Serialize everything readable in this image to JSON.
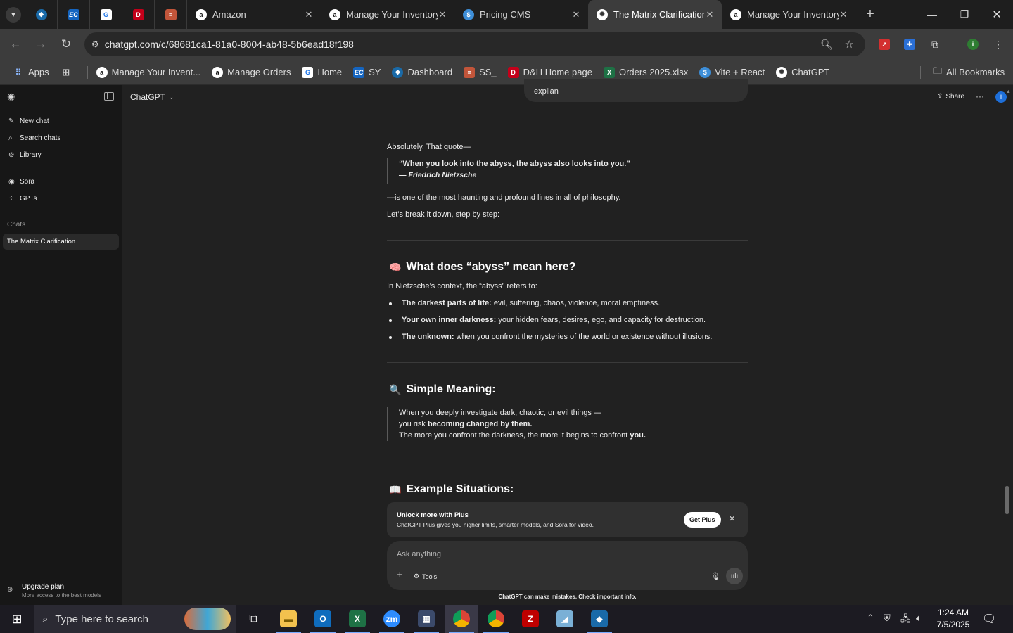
{
  "browser": {
    "tabs": [
      {
        "title": "Amazon",
        "icon": "amazon-icon"
      },
      {
        "title": "Manage Your Inventory",
        "icon": "amazon-icon"
      },
      {
        "title": "Pricing CMS",
        "icon": "dollar-icon"
      },
      {
        "title": "The Matrix Clarification",
        "icon": "chatgpt-icon",
        "active": true
      },
      {
        "title": "Manage Your Inventory",
        "icon": "amazon-icon"
      }
    ],
    "url": "chatgpt.com/c/68681ca1-81a0-8004-ab48-5b6ead18f198",
    "bookmarks": [
      {
        "label": "Apps",
        "icon": "apps-grid-icon"
      },
      {
        "label": "",
        "icon": "tab-groups-icon"
      },
      {
        "label": "Manage Your Invent...",
        "icon": "amazon-icon"
      },
      {
        "label": "Manage Orders",
        "icon": "amazon-icon"
      },
      {
        "label": "Home",
        "icon": "home-doc-icon"
      },
      {
        "label": "SY",
        "icon": "ec-icon"
      },
      {
        "label": "Dashboard",
        "icon": "diamond-icon"
      },
      {
        "label": "SS_",
        "icon": "stack-icon"
      },
      {
        "label": "D&H Home page",
        "icon": "dh-icon"
      },
      {
        "label": "Orders 2025.xlsx",
        "icon": "excel-icon"
      },
      {
        "label": "Vite + React",
        "icon": "dollar-icon"
      },
      {
        "label": "ChatGPT",
        "icon": "chatgpt-icon"
      }
    ],
    "all_bookmarks": "All Bookmarks"
  },
  "sidebar": {
    "nav": [
      {
        "label": "New chat",
        "icon": "edit-icon"
      },
      {
        "label": "Search chats",
        "icon": "search-icon"
      },
      {
        "label": "Library",
        "icon": "library-icon"
      },
      {
        "label": "Sora",
        "icon": "sora-icon"
      },
      {
        "label": "GPTs",
        "icon": "grid-icon"
      }
    ],
    "section_label": "Chats",
    "chats": [
      "The Matrix Clarification"
    ],
    "upgrade": {
      "title": "Upgrade plan",
      "subtitle": "More access to the best models"
    }
  },
  "header": {
    "model": "ChatGPT",
    "share": "Share",
    "avatar_letter": "I"
  },
  "conversation": {
    "user_message": "explian",
    "intro": "Absolutely. That quote—",
    "quote": "“When you look into the abyss, the abyss also looks into you.”",
    "quote_author": "— Friedrich Nietzsche",
    "p1": "—is one of the most haunting and profound lines in all of philosophy.",
    "p2": "Let’s break it down, step by step:",
    "section1_title": "What does “abyss” mean here?",
    "section1_emoji": "🧠",
    "section1_intro": "In Nietzsche’s context, the “abyss” refers to:",
    "bullets": [
      {
        "bold": "The darkest parts of life:",
        "text": " evil, suffering, chaos, violence, moral emptiness."
      },
      {
        "bold": "Your own inner darkness:",
        "text": " your hidden fears, desires, ego, and capacity for destruction."
      },
      {
        "bold": "The unknown:",
        "text": " when you confront the mysteries of the world or existence without illusions."
      }
    ],
    "section2_title": "Simple Meaning:",
    "section2_emoji": "🔍",
    "simple_line1": "When you deeply investigate dark, chaotic, or evil things —",
    "simple_line2_pre": "you risk ",
    "simple_line2_bold": "becoming changed by them.",
    "simple_line3_pre": "The more you confront the darkness, the more it begins to confront ",
    "simple_line3_bold": "you.",
    "section3_title": "Example Situations:",
    "section3_emoji": "📖"
  },
  "upsell": {
    "title": "Unlock more with Plus",
    "text": "ChatGPT Plus gives you higher limits, smarter models, and Sora for video.",
    "button": "Get Plus"
  },
  "composer": {
    "placeholder": "Ask anything",
    "tools": "Tools"
  },
  "disclaimer": "ChatGPT can make mistakes. Check important info.",
  "taskbar": {
    "search_placeholder": "Type here to search",
    "time": "1:24 AM",
    "date": "7/5/2025"
  },
  "colors": {
    "accent_blue": "#1e6fd9",
    "sidebar_bg": "#171717",
    "main_bg": "#212121"
  }
}
